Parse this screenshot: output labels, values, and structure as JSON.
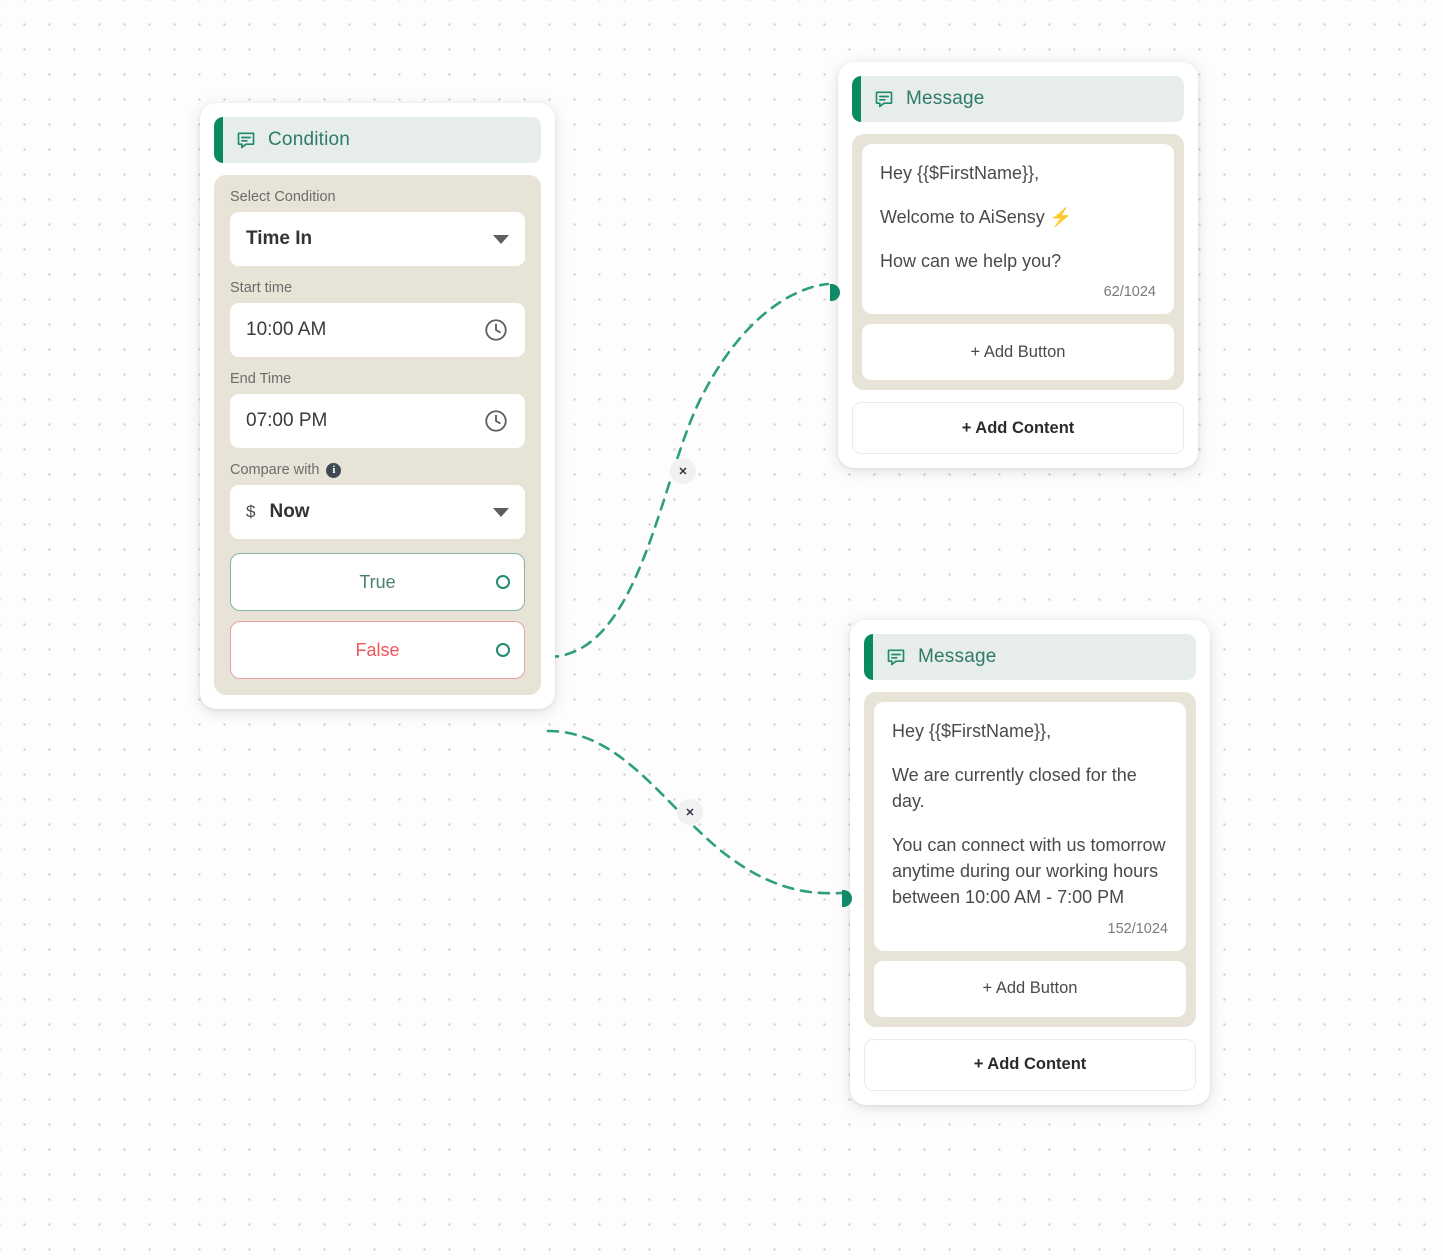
{
  "canvas": {
    "grid_dot_color": "#c9c9c9",
    "background": "#fdfdfd"
  },
  "theme": {
    "accent_green": "#0a8a5f",
    "header_bg": "#e7edea",
    "header_text": "#2f7a68",
    "body_bg": "#e7e3d7",
    "true_border": "#86b5a5",
    "true_text": "#4b7f72",
    "false_border": "#e8a0a6",
    "false_text": "#f2545b",
    "edge_color": "#2e9e7e",
    "bolt_color": "#f47b20"
  },
  "condition_node": {
    "header": {
      "title": "Condition",
      "icon": "message-square-icon"
    },
    "fields": [
      {
        "label": "Select Condition",
        "value": "Time In",
        "control": "dropdown"
      },
      {
        "label": "Start time",
        "value": "10:00 AM",
        "control": "time"
      },
      {
        "label": "End Time",
        "value": "07:00 PM",
        "control": "time"
      },
      {
        "label": "Compare with",
        "value": "Now",
        "prefix": "$",
        "control": "dropdown",
        "has_info": true
      }
    ],
    "branches": [
      {
        "label": "True",
        "handle": "source-handle-true"
      },
      {
        "label": "False",
        "handle": "source-handle-false"
      }
    ]
  },
  "message_nodes": [
    {
      "header": {
        "title": "Message",
        "icon": "message-square-icon"
      },
      "lines": [
        "Hey {{$FirstName}},",
        "Welcome to AiSensy ",
        "How can we help you?"
      ],
      "bolt_after_line": 1,
      "char_count": "62/1024",
      "add_button_label": "+ Add Button",
      "add_content_label": "+ Add Content"
    },
    {
      "header": {
        "title": "Message",
        "icon": "message-square-icon"
      },
      "lines": [
        "Hey {{$FirstName}},",
        "We are currently closed for the day.",
        "You can connect with us tomorrow anytime during our working hours between 10:00 AM - 7:00 PM"
      ],
      "bolt_after_line": -1,
      "char_count": "152/1024",
      "add_button_label": "+ Add Button",
      "add_content_label": "+ Add Content"
    }
  ],
  "edges": [
    {
      "from": "True",
      "to": "Message 1",
      "delete_label": "✕"
    },
    {
      "from": "False",
      "to": "Message 2",
      "delete_label": "✕"
    }
  ]
}
